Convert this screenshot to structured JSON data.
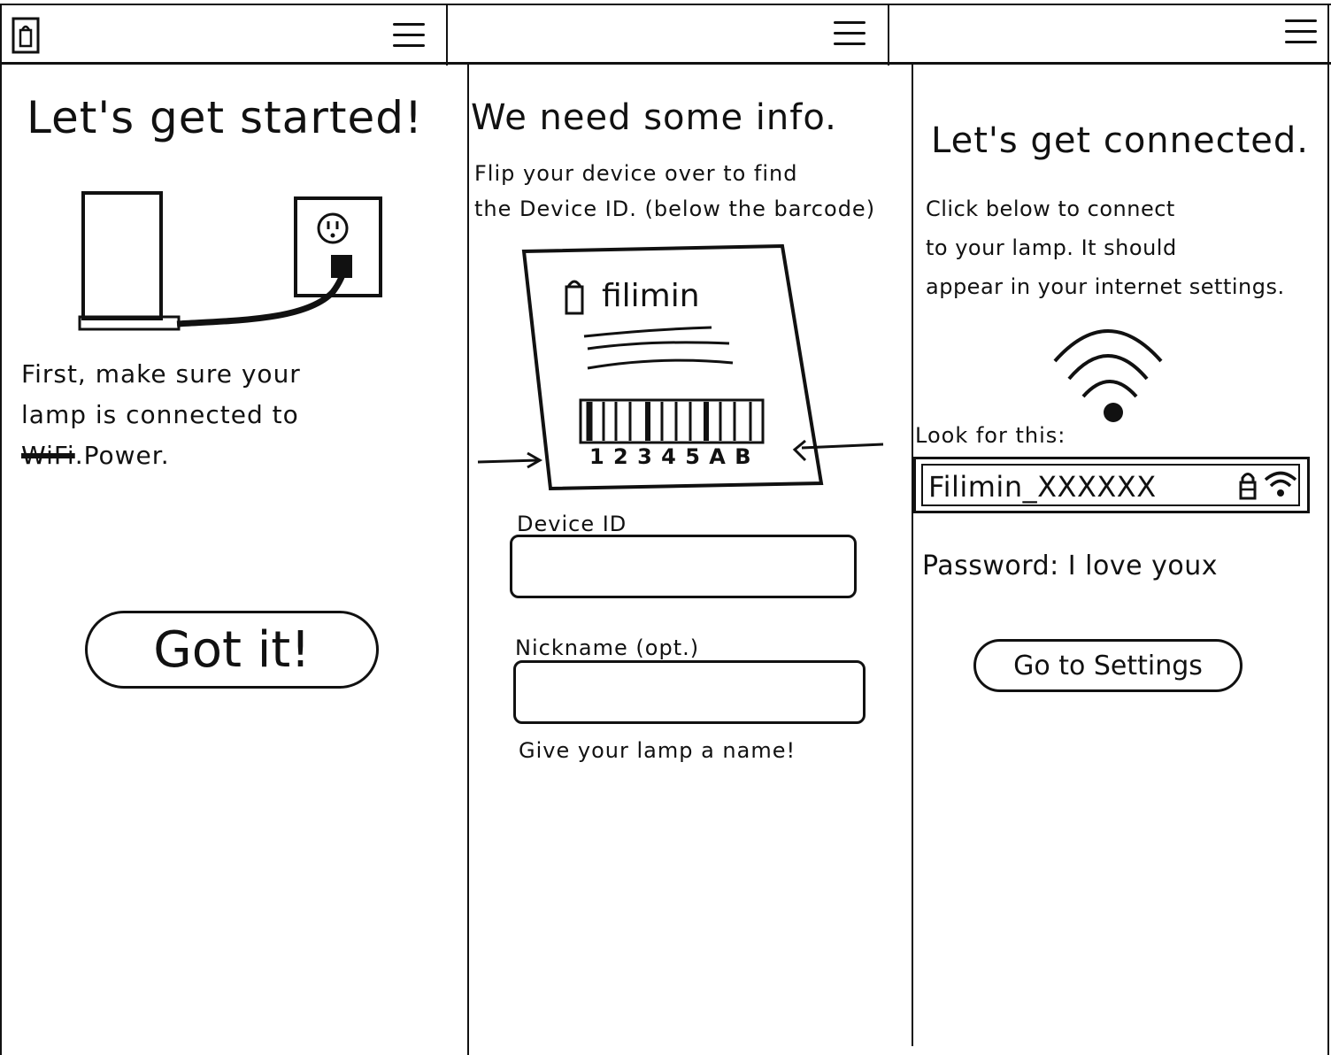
{
  "screen1": {
    "title": "Let's get started!",
    "instruction_line1": "First, make sure your",
    "instruction_line2": "lamp is connected to",
    "struck_word": "WiFi",
    "instruction_power": ".Power.",
    "cta_label": "Got it!"
  },
  "screen2": {
    "title": "We need some info.",
    "instruction_line1": "Flip your device over to find",
    "instruction_line2": "the Device ID. (below the barcode)",
    "label_brand": "filimin",
    "barcode_digits": "1 2 3 4 5 A B",
    "device_id_label": "Device ID",
    "nickname_label": "Nickname (opt.)",
    "nickname_helper": "Give your lamp a name!",
    "device_id_value": "",
    "nickname_value": ""
  },
  "screen3": {
    "title": "Let's get connected.",
    "instruction_line1": "Click below to connect",
    "instruction_line2": "to your lamp. It should",
    "instruction_line3": "appear in your internet settings.",
    "look_for_label": "Look for this:",
    "network_name": "Filimin_XXXXXX",
    "password_text": "Password: I love youx",
    "cta_label": "Go to Settings"
  },
  "icons": {
    "logo": "lamp-logo-icon",
    "menu": "hamburger-menu-icon",
    "wifi": "wifi-icon",
    "lock": "lock-icon"
  }
}
